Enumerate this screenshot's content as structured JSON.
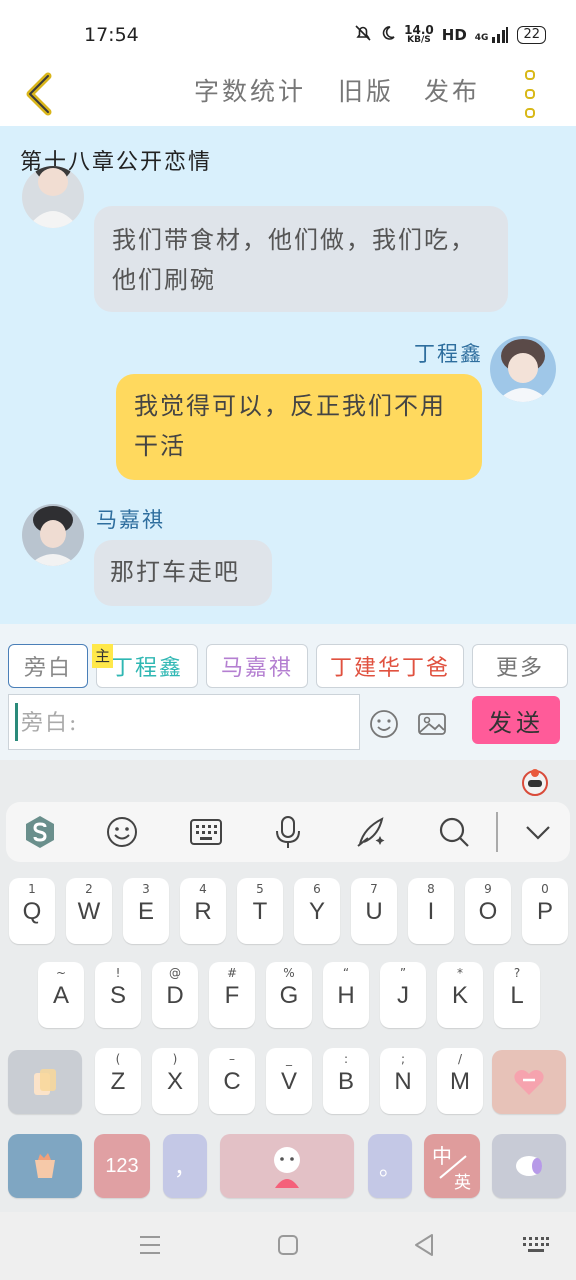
{
  "status_bar": {
    "time": "17:54",
    "speed_value": "14.0",
    "speed_unit": "KB/S",
    "hd": "HD",
    "network": "4G",
    "battery": "22"
  },
  "topbar": {
    "word_count": "字数统计",
    "old_version": "旧版",
    "publish": "发布"
  },
  "chat": {
    "chapter_title": "第十八章公开恋情",
    "messages": [
      {
        "speaker": "",
        "side": "left",
        "text": "我们带食材，他们做，我们吃，他们刷碗"
      },
      {
        "speaker": "丁程鑫",
        "side": "right",
        "text": "我觉得可以，反正我们不用干活"
      },
      {
        "speaker": "马嘉祺",
        "side": "left",
        "text": "那打车走吧"
      }
    ]
  },
  "roles": {
    "narration": "旁白",
    "main_badge": "主",
    "role1": "丁程鑫",
    "role2": "马嘉祺",
    "role3": "丁建华丁爸",
    "more": "更多"
  },
  "composer": {
    "placeholder": "旁白:",
    "send": "发送"
  },
  "keyboard": {
    "row1": [
      {
        "sub": "1",
        "key": "Q"
      },
      {
        "sub": "2",
        "key": "W"
      },
      {
        "sub": "3",
        "key": "E"
      },
      {
        "sub": "4",
        "key": "R"
      },
      {
        "sub": "5",
        "key": "T"
      },
      {
        "sub": "6",
        "key": "Y"
      },
      {
        "sub": "7",
        "key": "U"
      },
      {
        "sub": "8",
        "key": "I"
      },
      {
        "sub": "9",
        "key": "O"
      },
      {
        "sub": "0",
        "key": "P"
      }
    ],
    "row2": [
      {
        "sub": "~",
        "key": "A"
      },
      {
        "sub": "!",
        "key": "S"
      },
      {
        "sub": "@",
        "key": "D"
      },
      {
        "sub": "#",
        "key": "F"
      },
      {
        "sub": "%",
        "key": "G"
      },
      {
        "sub": "“",
        "key": "H"
      },
      {
        "sub": "”",
        "key": "J"
      },
      {
        "sub": "*",
        "key": "K"
      },
      {
        "sub": "?",
        "key": "L"
      }
    ],
    "row3": [
      {
        "sub": "(",
        "key": "Z"
      },
      {
        "sub": ")",
        "key": "X"
      },
      {
        "sub": "–",
        "key": "C"
      },
      {
        "sub": "_",
        "key": "V"
      },
      {
        "sub": ":",
        "key": "B"
      },
      {
        "sub": ";",
        "key": "N"
      },
      {
        "sub": "/",
        "key": "M"
      }
    ],
    "num_key": "123",
    "comma_key": "，",
    "period_key": "。",
    "lang_key_top": "中",
    "lang_key_bottom": "英",
    "colors": {
      "shift_key": "#c9cdd3",
      "heart_key": "#e7c2b8",
      "emoji_key": "#7fa6c2",
      "num_key": "#e0a0a3",
      "comma_key": "#c4c8e6",
      "space_key": "#e3c1c6",
      "period_key": "#c4c8e6",
      "lang_key": "#df9c9c",
      "return_key": "#c8cbd6"
    }
  }
}
